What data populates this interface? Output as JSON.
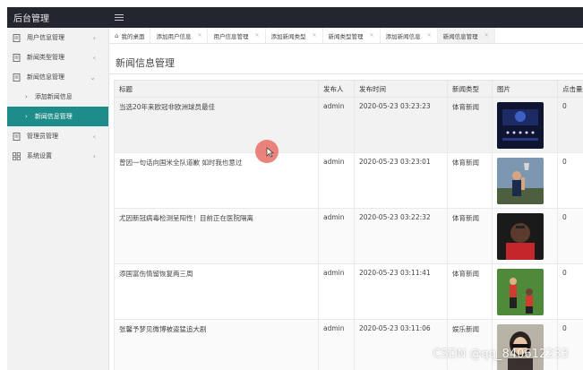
{
  "app": {
    "title": "后台管理"
  },
  "sidebar": {
    "items": [
      {
        "label": "用户信息管理",
        "icon": "document-icon",
        "arrow": "‹"
      },
      {
        "label": "新闻类型管理",
        "icon": "document-icon",
        "arrow": "‹"
      },
      {
        "label": "新闻信息管理",
        "icon": "document-icon",
        "arrow": "⌄"
      }
    ],
    "subitems": [
      {
        "label": "添加新闻信息",
        "caret": "›"
      },
      {
        "label": "新闻信息管理",
        "caret": "›"
      }
    ],
    "items2": [
      {
        "label": "管理员管理",
        "icon": "document-icon",
        "arrow": "‹"
      },
      {
        "label": "系统设置",
        "icon": "grid-icon",
        "arrow": "‹"
      }
    ]
  },
  "tabs": [
    {
      "label": "我的桌面",
      "home_icon": "⌂"
    },
    {
      "label": "添加用户信息",
      "close": "✕"
    },
    {
      "label": "用户信息管理",
      "close": "✕"
    },
    {
      "label": "添加新闻类型",
      "close": "✕"
    },
    {
      "label": "新闻类型管理",
      "close": "✕"
    },
    {
      "label": "添加新闻信息",
      "close": "✕"
    },
    {
      "label": "新闻信息管理",
      "close": "✕"
    }
  ],
  "page": {
    "title": "新闻信息管理"
  },
  "table": {
    "headers": [
      "标题",
      "发布人",
      "发布时间",
      "新闻类型",
      "图片",
      "点击量"
    ],
    "rows": [
      {
        "title": "当选20年来欧冠非欧洲球员最佳",
        "author": "admin",
        "time": "2020-05-23 03:23:23",
        "type": "体育新闻",
        "image": "dark-stage-photo",
        "clicks": "0"
      },
      {
        "title": "曾因一句话向国米全队道歉 如时我也意过",
        "author": "admin",
        "time": "2020-05-23 03:23:01",
        "type": "体育新闻",
        "image": "trophy-photo",
        "clicks": "0"
      },
      {
        "title": "尤因新冠病毒检测呈阳性！目前正在医院隔离",
        "author": "admin",
        "time": "2020-05-23 03:22:32",
        "type": "体育新闻",
        "image": "player-red-photo",
        "clicks": "0"
      },
      {
        "title": "添国富伤情留恢复两三周",
        "author": "admin",
        "time": "2020-05-23 03:11:41",
        "type": "体育新闻",
        "image": "field-players-photo",
        "clicks": "0"
      },
      {
        "title": "张馨予梦见微博被盗猛追大剧",
        "author": "admin",
        "time": "2020-05-23 03:11:06",
        "type": "娱乐新闻",
        "image": "portrait-photo",
        "clicks": "0"
      }
    ]
  },
  "watermark": "CSDN @qq_840612233",
  "colors": {
    "topbar": "#23262e",
    "sidebar_active": "#1e8c88",
    "cursor_highlight": "#e86e66"
  }
}
